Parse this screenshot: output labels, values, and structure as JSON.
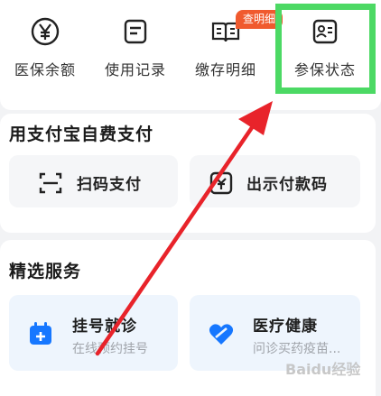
{
  "top_menu": {
    "items": [
      {
        "label": "医保余额",
        "icon": "yuan-circle-icon"
      },
      {
        "label": "使用记录",
        "icon": "document-icon"
      },
      {
        "label": "缴存明细",
        "icon": "open-book-icon"
      },
      {
        "label": "参保状态",
        "icon": "id-card-icon"
      }
    ],
    "badge": "查明细"
  },
  "pay_section": {
    "title": "用支付宝自费支付",
    "scan_label": "扫码支付",
    "show_code_label": "出示付款码"
  },
  "services": {
    "title": "精选服务",
    "items": [
      {
        "title": "挂号就诊",
        "subtitle": "在线预约挂号"
      },
      {
        "title": "医疗健康",
        "subtitle": "问诊买药疫苗..."
      }
    ]
  },
  "watermark": "Baidu经验",
  "colors": {
    "accent_blue": "#1677ff",
    "badge": "#f05a2e",
    "highlight": "#4cd964",
    "arrow": "#e8232a"
  }
}
